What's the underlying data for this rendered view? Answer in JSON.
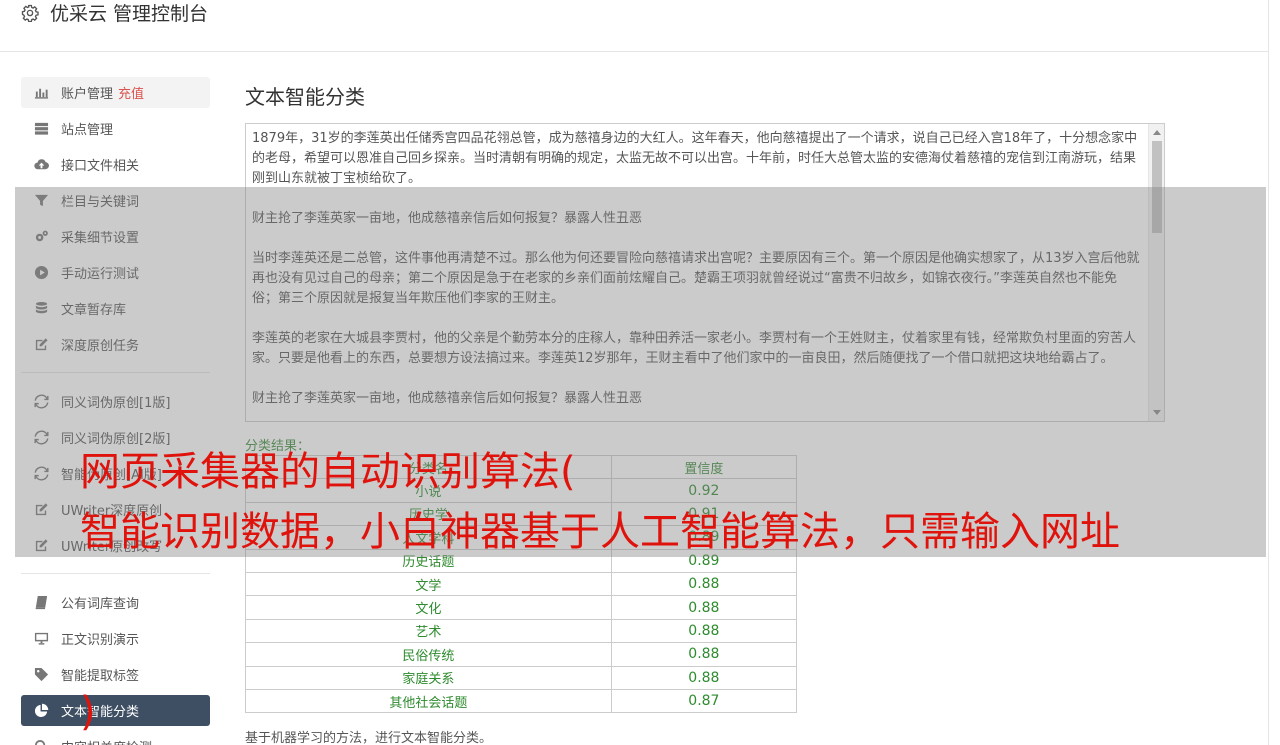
{
  "header": {
    "title": "优采云 管理控制台",
    "icon": "gear-icon"
  },
  "sidebar": {
    "items": [
      {
        "label": "账户管理",
        "accent": "充值",
        "icon": "bar-chart-icon"
      },
      {
        "label": "站点管理",
        "icon": "server-icon"
      },
      {
        "label": "接口文件相关",
        "icon": "cloud-upload-icon"
      },
      {
        "label": "栏目与关键词",
        "icon": "filter-icon"
      },
      {
        "label": "采集细节设置",
        "icon": "cogs-icon"
      },
      {
        "label": "手动运行测试",
        "icon": "play-circle-icon"
      },
      {
        "label": "文章暂存库",
        "icon": "database-icon"
      },
      {
        "label": "深度原创任务",
        "icon": "edit-icon"
      },
      {
        "label": "同义词伪原创[1版]",
        "icon": "refresh-icon"
      },
      {
        "label": "同义词伪原创[2版]",
        "icon": "refresh-icon"
      },
      {
        "label": "智能伪原创[AI版]",
        "icon": "refresh-icon"
      },
      {
        "label": "UWriter深度原创",
        "icon": "edit-icon"
      },
      {
        "label": "UWriter原创改写",
        "icon": "edit-icon"
      },
      {
        "label": "公有词库查询",
        "icon": "book-icon"
      },
      {
        "label": "正文识别演示",
        "icon": "monitor-icon"
      },
      {
        "label": "智能提取标签",
        "icon": "tag-icon"
      },
      {
        "label": "文本智能分类",
        "icon": "pie-chart-icon"
      },
      {
        "label": "内容相关度检测",
        "icon": "search-icon"
      }
    ]
  },
  "main": {
    "title": "文本智能分类",
    "text": "1879年，31岁的李莲英出任储秀宫四品花翎总管，成为慈禧身边的大红人。这年春天，他向慈禧提出了一个请求，说自己已经入宫18年了，十分想念家中的老母，希望可以恩准自己回乡探亲。当时清朝有明确的规定，太监无故不可以出宫。十年前，时任大总管太监的安德海仗着慈禧的宠信到江南游玩，结果刚到山东就被丁宝桢给砍了。\n\n财主抢了李莲英家一亩地，他成慈禧亲信后如何报复？暴露人性丑恶\n\n当时李莲英还是二总管，这件事他再清楚不过。那么他为何还要冒险向慈禧请求出宫呢？主要原因有三个。第一个原因是他确实想家了，从13岁入宫后他就再也没有见过自己的母亲；第二个原因是急于在老家的乡亲们面前炫耀自己。楚霸王项羽就曾经说过“富贵不归故乡，如锦衣夜行。”李莲英自然也不能免俗；第三个原因就是报复当年欺压他们李家的王财主。\n\n李莲英的老家在大城县李贾村，他的父亲是个勤劳本分的庄稼人，靠种田养活一家老小。李贾村有一个王姓财主，仗着家里有钱，经常欺负村里面的穷苦人家。只要是他看上的东西，总要想方设法搞过来。李莲英12岁那年，王财主看中了他们家中的一亩良田，然后随便找了一个借口就把这块地给霸占了。\n\n财主抢了李莲英家一亩地，他成慈禧亲信后如何报复？暴露人性丑恶",
    "result_label": "分类结果：",
    "table": {
      "headers": [
        "分类名",
        "置信度"
      ],
      "rows": [
        [
          "小说",
          "0.92"
        ],
        [
          "历史学",
          "0.91"
        ],
        [
          "人文学科",
          "0.89"
        ],
        [
          "历史话题",
          "0.89"
        ],
        [
          "文学",
          "0.88"
        ],
        [
          "文化",
          "0.88"
        ],
        [
          "艺术",
          "0.88"
        ],
        [
          "民俗传统",
          "0.88"
        ],
        [
          "家庭关系",
          "0.88"
        ],
        [
          "其他社会话题",
          "0.87"
        ]
      ]
    },
    "footer": "基于机器学习的方法，进行文本智能分类。"
  },
  "banner": {
    "line1": "网页采集器的自动识别算法(",
    "line2": "智能识别数据，小白神器基于人工智能算法，只需输入网址",
    "line3": ")"
  },
  "colors": {
    "accent": "#d9534f",
    "active_bg": "#3f4f63",
    "result_green": "#2e8b2e",
    "banner_red": "#e0130c"
  }
}
